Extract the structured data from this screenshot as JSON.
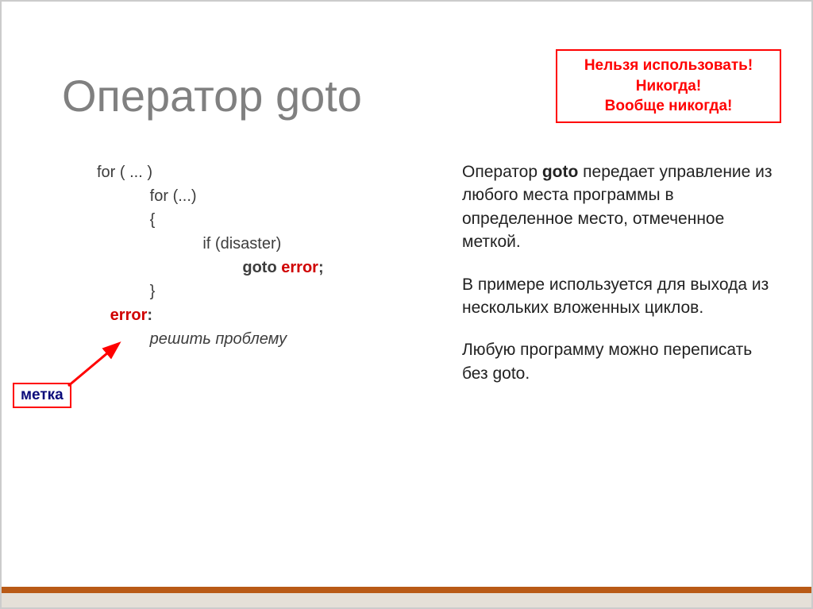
{
  "title": "Оператор goto",
  "warning": {
    "line1": "Нельзя использовать!",
    "line2": "Никогда!",
    "line3": "Вообще никогда!"
  },
  "code": {
    "l1": "for ( ... )",
    "l2": "            for (...)",
    "l3": "            {",
    "l4": "                        if (disaster)",
    "l5a": "                                 goto ",
    "l5b": "error",
    "l5c": ";",
    "l6": "            }",
    "l7": "",
    "l8a": "   ",
    "l8b": "error",
    "l8c": ":",
    "l9": "            решить проблему"
  },
  "desc": {
    "p1a": "Оператор ",
    "p1b": "goto",
    "p1c": " передает управление из любого места программы в определенное место, отмеченное меткой.",
    "p2": "В примере используется для выхода из нескольких вложенных циклов.",
    "p3": "Любую программу можно переписать без goto."
  },
  "label": "метка"
}
